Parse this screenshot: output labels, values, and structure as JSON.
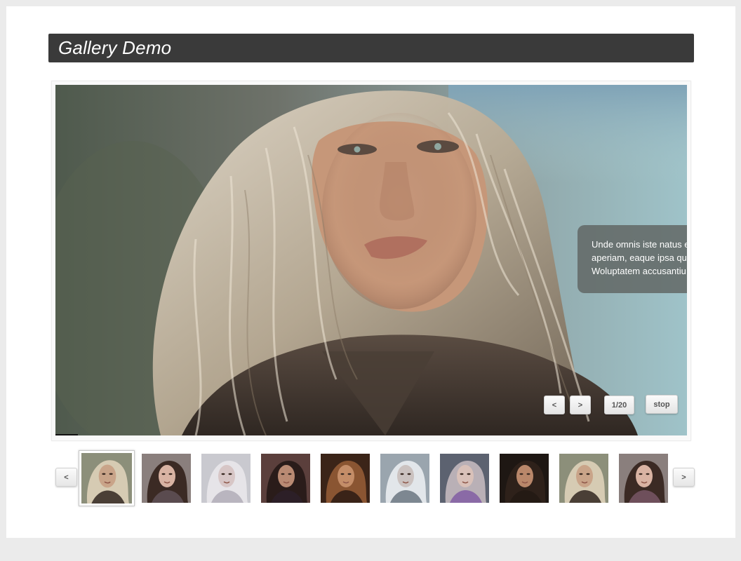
{
  "page": {
    "title": "Gallery Demo"
  },
  "slideshow": {
    "caption_lines": [
      "Unde omnis iste natus e",
      "aperiam, eaque ipsa qu",
      "Woluptatem accusantiu"
    ],
    "prev_label": "<",
    "next_label": ">",
    "counter": "1/20",
    "stop_label": "stop",
    "current_index": 1,
    "total": 20,
    "progress_fraction": 0.035
  },
  "thumbnails": {
    "prev_label": "<",
    "next_label": ">",
    "active_index": 0,
    "items": [
      {
        "bg": "#8c8f7a",
        "hair": "#d6cbb3",
        "skin": "#c9a489",
        "cloth": "#4a3f36"
      },
      {
        "bg": "#8a7f7d",
        "hair": "#3b2a24",
        "skin": "#d9b3a3",
        "cloth": "#5a4b4f"
      },
      {
        "bg": "#c9c9cf",
        "hair": "#e6e4e8",
        "skin": "#d7c6c6",
        "cloth": "#b9b5bf"
      },
      {
        "bg": "#5b3f3c",
        "hair": "#2a1c1a",
        "skin": "#b98a73",
        "cloth": "#2c1f27"
      },
      {
        "bg": "#3b2418",
        "hair": "#8a5532",
        "skin": "#c48d68",
        "cloth": "#3a2318"
      },
      {
        "bg": "#9aa5ae",
        "hair": "#e2e6ea",
        "skin": "#cbc2c0",
        "cloth": "#7d8791"
      },
      {
        "bg": "#5c6270",
        "hair": "#b9b0b6",
        "skin": "#d9c1b9",
        "cloth": "#8a6aa6"
      },
      {
        "bg": "#1e1713",
        "hair": "#2e211a",
        "skin": "#b9876a",
        "cloth": "#241a14"
      },
      {
        "bg": "#8c8f7a",
        "hair": "#d6cbb3",
        "skin": "#c9a489",
        "cloth": "#4a3f36"
      },
      {
        "bg": "#8a7f7d",
        "hair": "#3b2a24",
        "skin": "#d9b3a3",
        "cloth": "#6e4f5b"
      }
    ]
  }
}
